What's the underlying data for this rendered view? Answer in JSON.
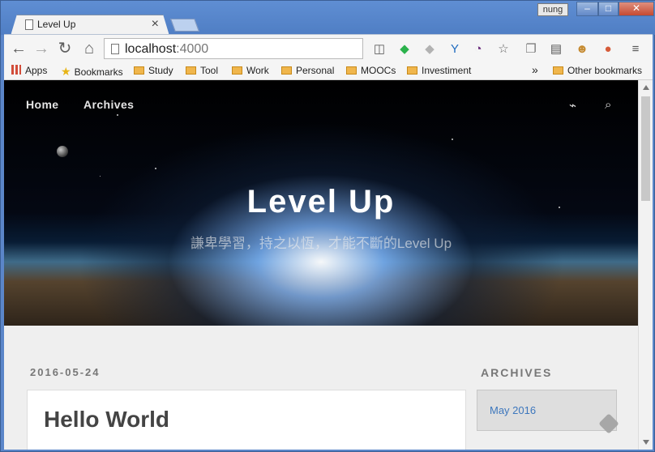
{
  "browser": {
    "tab_title": "Level Up",
    "tab_close": "×",
    "profile_name": "nung",
    "window_buttons": {
      "minimize": "–",
      "maximize": "□",
      "close": "✕"
    },
    "address": {
      "host": "localhost",
      "port": ":4000"
    },
    "nav_buttons": {
      "back": "←",
      "forward": "→",
      "reload": "↻",
      "home": "⌂"
    },
    "extensions": [
      {
        "icon": "pocket-icon",
        "symbol": "◫",
        "color": "#606060"
      },
      {
        "icon": "feedly-icon",
        "symbol": "◆",
        "color": "#2bb24c"
      },
      {
        "icon": "feedly-gray-icon",
        "symbol": "◆",
        "color": "#b2b2b2"
      },
      {
        "icon": "y-icon",
        "symbol": "Y",
        "color": "#1f6bbf"
      },
      {
        "icon": "speedometer-icon",
        "symbol": "◔",
        "color": "#6b2d7d"
      },
      {
        "icon": "bookmark-star-icon",
        "symbol": "☆",
        "color": "#666"
      },
      {
        "icon": "copy-icon",
        "symbol": "❐",
        "color": "#777"
      },
      {
        "icon": "trello-icon",
        "symbol": "▤",
        "color": "#555"
      },
      {
        "icon": "pixel-face-icon",
        "symbol": "☻",
        "color": "#c58a30"
      },
      {
        "icon": "colorful-extension-icon",
        "symbol": "●",
        "color": "#d65b39"
      },
      {
        "icon": "menu-icon",
        "symbol": "≡",
        "color": "#555"
      }
    ]
  },
  "bookmarks": {
    "apps": "Apps",
    "items": [
      "Bookmarks",
      "Study",
      "Tool",
      "Work",
      "Personal",
      "MOOCs",
      "Investiment"
    ],
    "overflow": "»",
    "other": "Other bookmarks"
  },
  "site": {
    "nav_home": "Home",
    "nav_archives": "Archives",
    "title": "Level Up",
    "subtitle": "謙卑學習，持之以恆，才能不斷的Level Up",
    "rss_icon": "⌁",
    "search_icon": "⌕"
  },
  "content": {
    "post_date": "2016-05-24",
    "post_title": "Hello World",
    "archives_heading": "ARCHIVES",
    "archive_link": "May 2016"
  }
}
